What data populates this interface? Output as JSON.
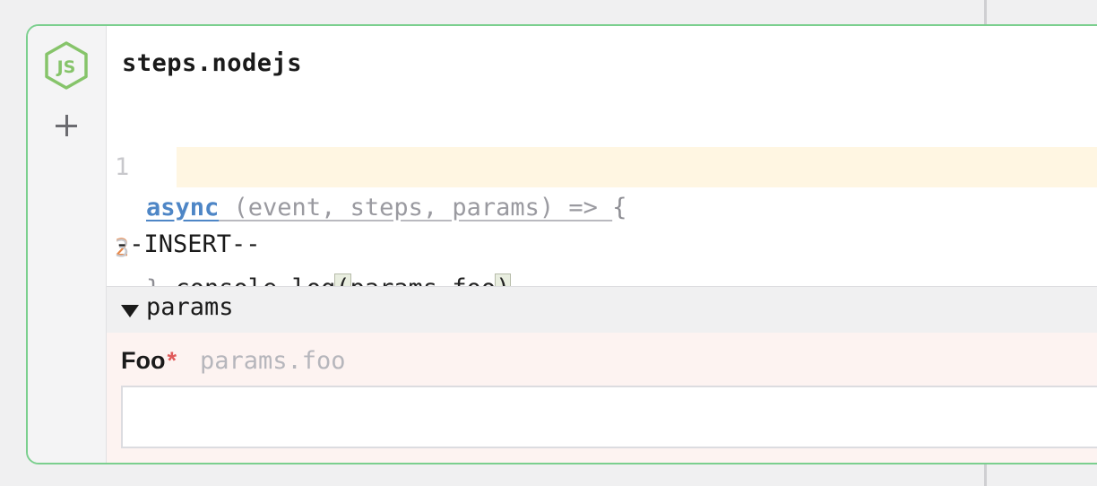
{
  "step": {
    "title": "steps.nodejs",
    "icon": "nodejs-icon"
  },
  "editor": {
    "lines": [
      {
        "number": "1",
        "keyword": "async",
        "rest": " (event, steps, params) => ",
        "brace": "{"
      },
      {
        "number": "2",
        "indent": "  ",
        "pre": "console.log",
        "open": "(",
        "mid": "params.foo",
        "close": ")"
      },
      {
        "number": "3",
        "brace": "}"
      }
    ],
    "mode": "--INSERT--"
  },
  "params": {
    "section_label": "params",
    "fields": [
      {
        "label": "Foo",
        "required_mark": "*",
        "path": "params.foo",
        "value": ""
      }
    ]
  },
  "colors": {
    "card_border": "#7bcf8e",
    "keyword": "#4e86c6",
    "active_line_number": "#e8884a",
    "active_line_bg": "#fff6e2",
    "required": "#e05a5a",
    "params_bg": "#fdf3f1"
  }
}
